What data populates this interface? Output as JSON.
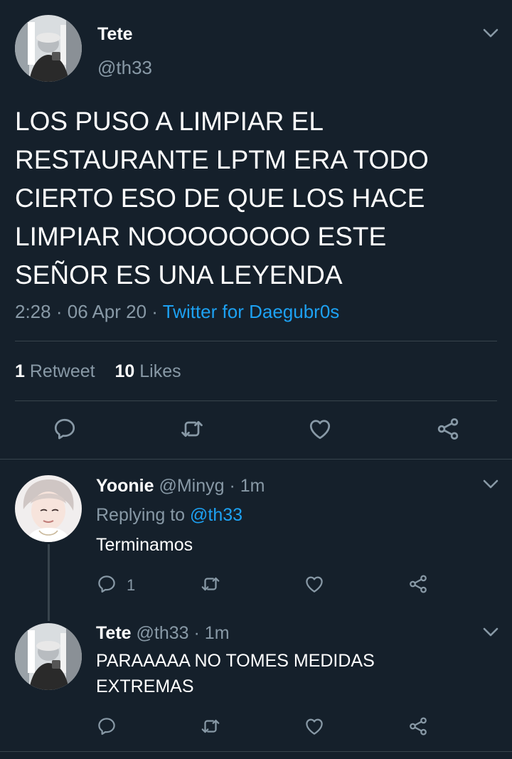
{
  "main_tweet": {
    "name": "Tete",
    "handle": "@th33",
    "text": "LOS PUSO A LIMPIAR EL\nRESTAURANTE LPTM ERA TODO\nCIERTO ESO DE QUE LOS HACE\nLIMPIAR NOOOOOOOO ESTE\nSEÑOR ES UNA LEYENDA",
    "time": "2:28",
    "separator": "·",
    "date": "06 Apr 20",
    "source": "Twitter for Daegubr0s",
    "retweet_count": "1",
    "retweet_label": "Retweet",
    "like_count": "10",
    "like_label": "Likes"
  },
  "replies": [
    {
      "name": "Yoonie",
      "handle": "@Minyg",
      "separator": "·",
      "time": "1m",
      "replying_prefix": "Replying to",
      "replying_handle": "@th33",
      "text": "Terminamos",
      "reply_count": "1"
    },
    {
      "name": "Tete",
      "handle": "@th33",
      "separator": "·",
      "time": "1m",
      "text": "PARAAAAA NO TOMES MEDIDAS EXTREMAS"
    }
  ],
  "icons": {
    "reply": "reply-icon",
    "retweet": "retweet-icon",
    "like": "heart-icon",
    "share": "share-icon",
    "menu": "chevron-down-icon"
  },
  "colors": {
    "background": "#15202b",
    "muted_text": "#8899a6",
    "link": "#1da1f2",
    "divider": "#38444d"
  }
}
